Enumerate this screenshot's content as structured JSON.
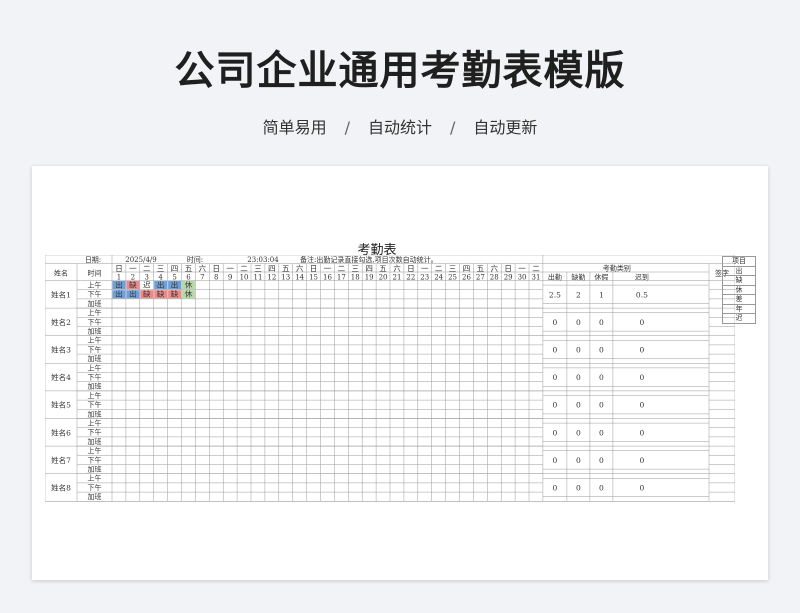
{
  "header": {
    "title": "公司企业通用考勤表模版",
    "tags": [
      "简单易用",
      "自动统计",
      "自动更新"
    ],
    "separator": "/"
  },
  "sheet": {
    "title": "考勤表",
    "date_label": "日期:",
    "date_value": "2025/4/9",
    "time_label": "时间:",
    "time_value": "23:03:04",
    "note": "备注:出勤记录直接勾选,项目次数自动统计。",
    "name_header": "姓名",
    "time_header": "时间",
    "category_header": "考勤类别",
    "sign_header": "签字",
    "stat_headers": [
      "出勤",
      "缺勤",
      "休假",
      "迟到"
    ],
    "weekdays": [
      "日",
      "一",
      "二",
      "三",
      "四",
      "五",
      "六",
      "日",
      "一",
      "二",
      "三",
      "四",
      "五",
      "六",
      "日",
      "一",
      "二",
      "三",
      "四",
      "五",
      "六",
      "日",
      "一",
      "二",
      "三",
      "四",
      "五",
      "六",
      "日",
      "一",
      "二"
    ],
    "slots": [
      "上午",
      "下午",
      "加班"
    ],
    "employees": [
      {
        "name": "姓名1",
        "stats": [
          "2.5",
          "2",
          "1",
          "0.5"
        ]
      },
      {
        "name": "姓名2",
        "stats": [
          "0",
          "0",
          "0",
          "0"
        ]
      },
      {
        "name": "姓名3",
        "stats": [
          "0",
          "0",
          "0",
          "0"
        ]
      },
      {
        "name": "姓名4",
        "stats": [
          "0",
          "0",
          "0",
          "0"
        ]
      },
      {
        "name": "姓名5",
        "stats": [
          "0",
          "0",
          "0",
          "0"
        ]
      },
      {
        "name": "姓名6",
        "stats": [
          "0",
          "0",
          "0",
          "0"
        ]
      },
      {
        "name": "姓名7",
        "stats": [
          "0",
          "0",
          "0",
          "0"
        ]
      },
      {
        "name": "姓名8",
        "stats": [
          "0",
          "0",
          "0",
          "0"
        ]
      }
    ],
    "marks": [
      {
        "row": 0,
        "day": 1,
        "text": "出",
        "color": "#6f9fd8"
      },
      {
        "row": 0,
        "day": 2,
        "text": "缺",
        "color": "#e98b8b"
      },
      {
        "row": 0,
        "day": 3,
        "text": "迟",
        "color": ""
      },
      {
        "row": 0,
        "day": 4,
        "text": "出",
        "color": "#6f9fd8"
      },
      {
        "row": 0,
        "day": 5,
        "text": "出",
        "color": "#6f9fd8"
      },
      {
        "row": 0,
        "day": 6,
        "text": "休",
        "color": "#b7d9a8"
      },
      {
        "row": 1,
        "day": 1,
        "text": "出",
        "color": "#6f9fd8"
      },
      {
        "row": 1,
        "day": 2,
        "text": "出",
        "color": "#6f9fd8"
      },
      {
        "row": 1,
        "day": 3,
        "text": "缺",
        "color": "#e98b8b"
      },
      {
        "row": 1,
        "day": 4,
        "text": "缺",
        "color": "#e98b8b"
      },
      {
        "row": 1,
        "day": 5,
        "text": "缺",
        "color": "#e98b8b"
      },
      {
        "row": 1,
        "day": 6,
        "text": "休",
        "color": "#b7d9a8"
      }
    ],
    "legend": [
      "项目",
      "出",
      "缺",
      "休",
      "差",
      "年",
      "迟"
    ]
  }
}
